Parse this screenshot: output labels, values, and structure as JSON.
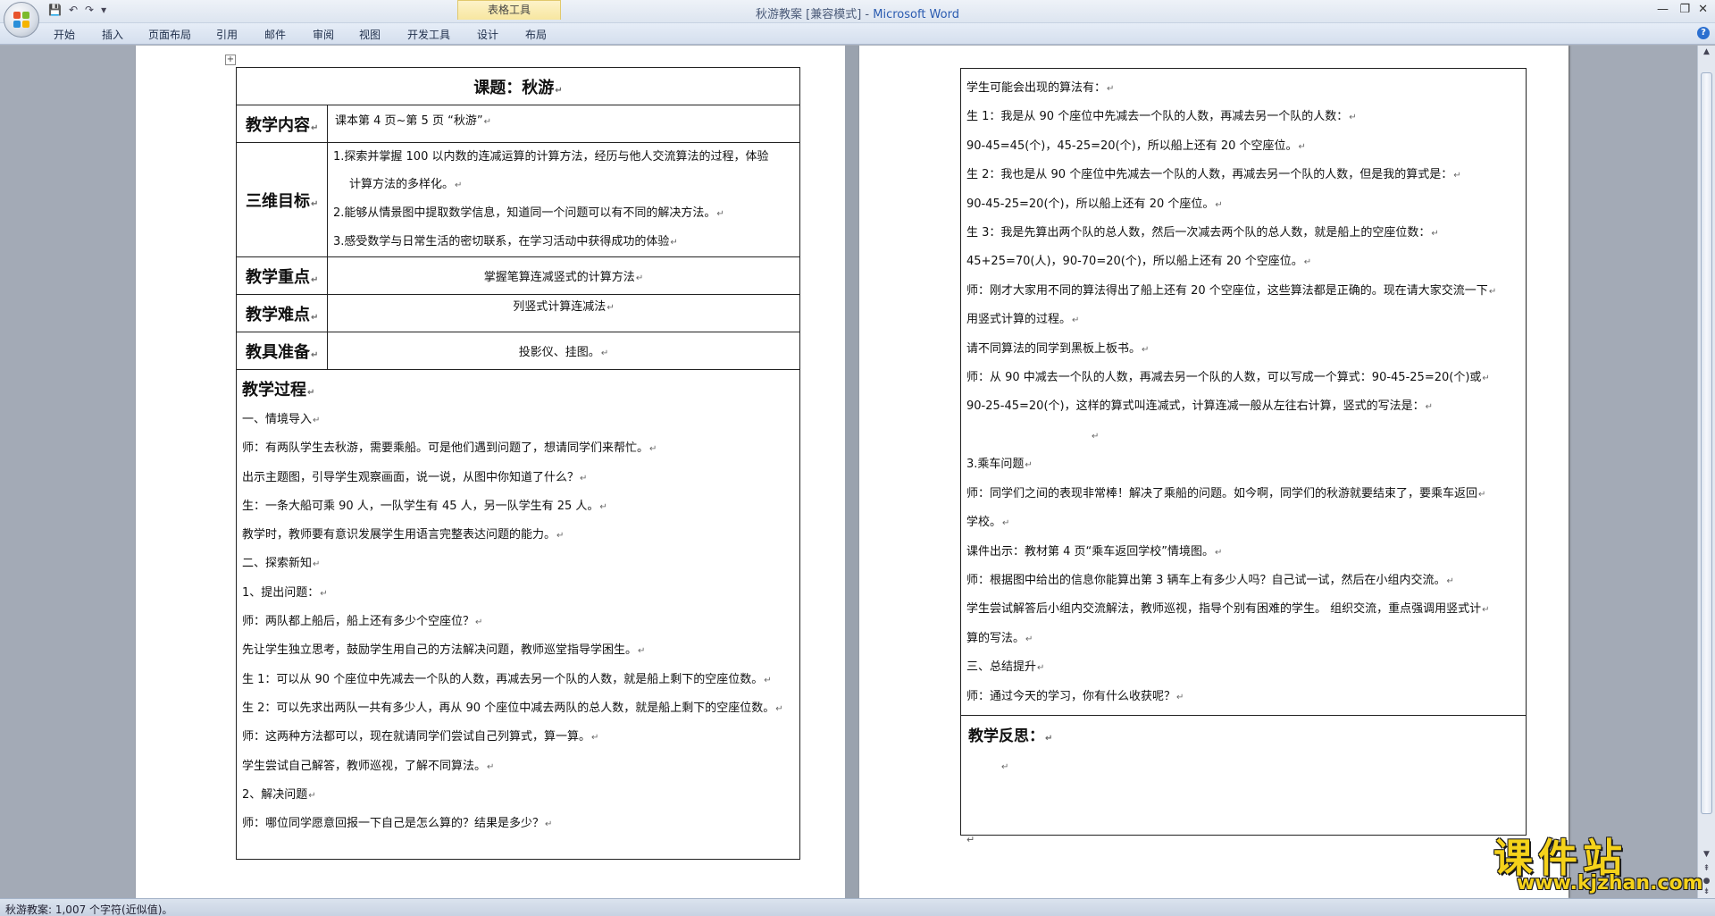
{
  "window": {
    "title_doc": "秋游教案 [兼容模式] - ",
    "title_app": "Microsoft Word",
    "context_tab_header": "表格工具"
  },
  "qat": {
    "save_icon": "save-icon",
    "undo": "↶",
    "redo": "↷",
    "customize": "▾"
  },
  "ribbon": {
    "tabs": [
      "开始",
      "插入",
      "页面布局",
      "引用",
      "邮件",
      "审阅",
      "视图",
      "开发工具",
      "设计",
      "布局"
    ]
  },
  "page_left": {
    "title": "课题：秋游",
    "rows": {
      "content_label": "教学内容",
      "content_value": "课本第 4 页~第 5 页 “秋游”",
      "goals_label": "三维目标",
      "goals": [
        "1.探索并掌握 100 以内数的连减运算的计算方法，经历与他人交流算法的过程，体验",
        "计算方法的多样化。",
        "2.能够从情景图中提取数学信息，知道同一个问题可以有不同的解决方法。",
        "3.感受数学与日常生活的密切联系，在学习活动中获得成功的体验"
      ],
      "key_label": "教学重点",
      "key_value": "掌握笔算连减竖式的计算方法",
      "difficult_label": "教学难点",
      "difficult_value": "列竖式计算连减法",
      "prep_label": "教具准备",
      "prep_value": "投影仪、挂图。"
    },
    "process_title": "教学过程",
    "process_lines": [
      "一、情境导入",
      " 师：有两队学生去秋游，需要乘船。可是他们遇到问题了，想请同学们来帮忙。",
      " 出示主题图，引导学生观察画面，说一说，从图中你知道了什么？",
      " 生：一条大船可乘 90 人，一队学生有 45 人，另一队学生有 25 人。",
      " 教学时，教师要有意识发展学生用语言完整表达问题的能力。",
      "二、探索新知",
      "  1、提出问题：",
      " 师：两队都上船后，船上还有多少个空座位？",
      "先让学生独立思考，鼓励学生用自己的方法解决问题，教师巡堂指导学困生。",
      "生 1：可以从 90 个座位中先减去一个队的人数，再减去另一个队的人数，就是船上剩下的空座位数。",
      "生 2：可以先求出两队一共有多少人，再从 90 个座位中减去两队的总人数，就是船上剩下的空座位数。",
      "师：这两种方法都可以，现在就请同学们尝试自己列算式，算一算。",
      "学生尝试自己解答，教师巡视，了解不同算法。",
      "  2、解决问题",
      "师：哪位同学愿意回报一下自己是怎么算的？结果是多少？"
    ]
  },
  "page_right": {
    "lines": [
      "学生可能会出现的算法有：",
      "生 1：我是从 90 个座位中先减去一个队的人数，再减去另一个队的人数：",
      "90-45=45(个)，45-25=20(个)，所以船上还有 20 个空座位。",
      "生 2：我也是从 90 个座位中先减去一个队的人数，再减去另一个队的人数，但是我的算式是：",
      "90-45-25=20(个)，所以船上还有 20 个座位。",
      "生 3：我是先算出两个队的总人数，然后一次减去两个队的总人数，就是船上的空座位数：",
      "45+25=70(人)，90-70=20(个)，所以船上还有 20 个空座位。",
      "师：刚才大家用不同的算法得出了船上还有 20 个空座位，这些算法都是正确的。现在请大家交流一下",
      "用竖式计算的过程。",
      "请不同算法的同学到黑板上板书。",
      " 师：从 90 中减去一个队的人数，再减去另一个队的人数，可以写成一个算式：90-45-25=20(个)或",
      "90-25-45=20(个)，这样的算式叫连减式，计算连减一般从左往右计算，竖式的写法是：",
      "",
      "",
      "3.乘车问题",
      "师：同学们之间的表现非常棒！解决了乘船的问题。如今啊，同学们的秋游就要结束了，要乘车返回",
      "学校。",
      "课件出示：教材第 4 页“乘车返回学校”情境图。",
      " 师：根据图中给出的信息你能算出第 3 辆车上有多少人吗？自己试一试，然后在小组内交流。",
      "学生尝试解答后小组内交流解法，教师巡视，指导个别有困难的学生。 组织交流，重点强调用竖式计",
      "算的写法。",
      "三、总结提升",
      "师：通过今天的学习，你有什么收获呢？"
    ],
    "reflect_title": "教学反思："
  },
  "status": {
    "text": "秋游教案: 1,007 个字符(近似值)。"
  },
  "watermark": {
    "main": "课件站",
    "url": "www.kjzhan.com"
  },
  "colors": {
    "accent": "#2a5bb0",
    "watermark": "#f5d21a",
    "context_tab": "#f7e6a0"
  }
}
